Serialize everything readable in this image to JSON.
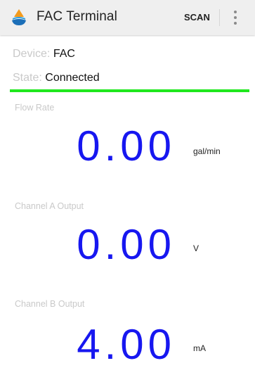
{
  "app": {
    "title": "FAC Terminal"
  },
  "toolbar": {
    "scan_label": "SCAN"
  },
  "device": {
    "key": "Device:",
    "value": "FAC"
  },
  "state": {
    "key": "State:",
    "value": "Connected",
    "indicator_color": "#20e81e"
  },
  "readings": [
    {
      "label": "Flow Rate",
      "value": "0.00",
      "unit": "gal/min"
    },
    {
      "label": "Channel A Output",
      "value": "0.00",
      "unit": "V"
    },
    {
      "label": "Channel B Output",
      "value": "4.00",
      "unit": "mA"
    }
  ],
  "colors": {
    "reading": "#1717f0",
    "appbar": "#efefef",
    "label": "#c9c9c9"
  },
  "icons": {
    "app": "water-drop-logo-icon",
    "overflow": "more-vertical-icon"
  }
}
